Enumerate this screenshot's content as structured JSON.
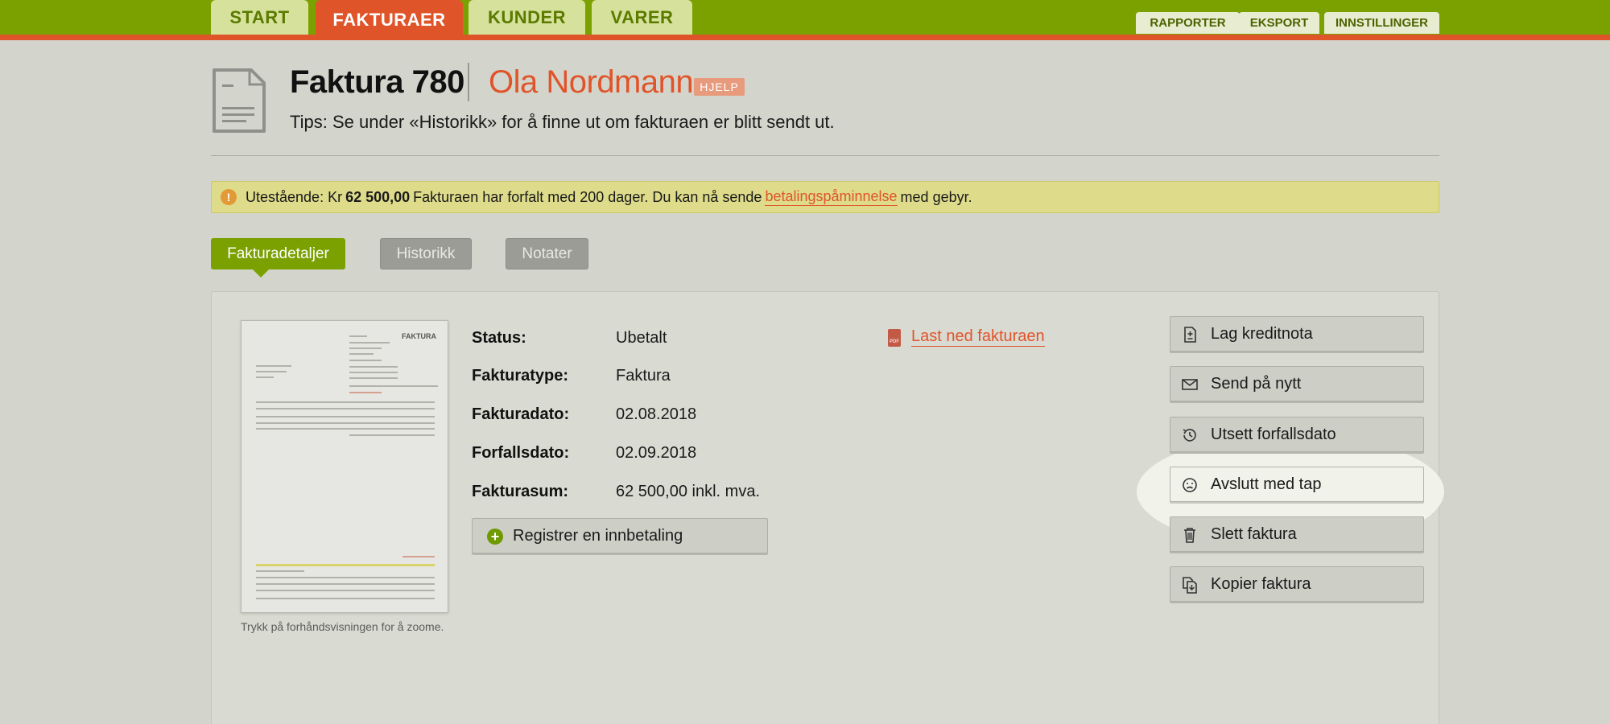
{
  "nav": {
    "main_tabs": [
      "START",
      "FAKTURAER",
      "KUNDER",
      "VARER"
    ],
    "active_main_tab": "FAKTURAER",
    "secondary_tabs": [
      "RAPPORTER",
      "EKSPORT",
      "INNSTILLINGER"
    ]
  },
  "header": {
    "title": "Faktura 780",
    "customer": "Ola Nordmann",
    "help_badge": "HJELP",
    "tips": "Tips: Se under «Historikk» for å finne ut om fakturaen er blitt sendt ut."
  },
  "alert": {
    "icon": "exclamation-icon",
    "prefix": "Utestående: Kr",
    "amount": "62 500,00",
    "middle": "Fakturaen har forfalt med 200 dager. Du kan nå sende",
    "link": "betalingspåminnelse",
    "suffix": "med gebyr."
  },
  "section_tabs": [
    "Fakturadetaljer",
    "Historikk",
    "Notater"
  ],
  "active_section_tab": "Fakturadetaljer",
  "preview": {
    "heading": "FAKTURA",
    "caption": "Trykk på forhåndsvisningen for å zoome."
  },
  "details": [
    {
      "label": "Status:",
      "value": "Ubetalt"
    },
    {
      "label": "Fakturatype:",
      "value": "Faktura"
    },
    {
      "label": "Fakturadato:",
      "value": "02.08.2018"
    },
    {
      "label": "Forfallsdato:",
      "value": "02.09.2018"
    },
    {
      "label": "Fakturasum:",
      "value": "62 500,00 inkl. mva."
    }
  ],
  "register_payment": "Registrer en innbetaling",
  "download": {
    "icon_text": "PDF",
    "label": "Last ned fakturaen"
  },
  "actions": [
    {
      "label": "Lag kreditnota",
      "icon": "credit-note-icon"
    },
    {
      "label": "Send på nytt",
      "icon": "envelope-icon"
    },
    {
      "label": "Utsett forfallsdato",
      "icon": "clock-icon"
    },
    {
      "label": "Avslutt med tap",
      "icon": "sad-face-icon"
    },
    {
      "label": "Slett faktura",
      "icon": "trash-icon"
    },
    {
      "label": "Kopier faktura",
      "icon": "copy-icon"
    }
  ],
  "colors": {
    "brand_green": "#7aa100",
    "accent_orange": "#e0542a",
    "alert_yellow": "#dedb8a",
    "background": "#d3d5cc"
  }
}
